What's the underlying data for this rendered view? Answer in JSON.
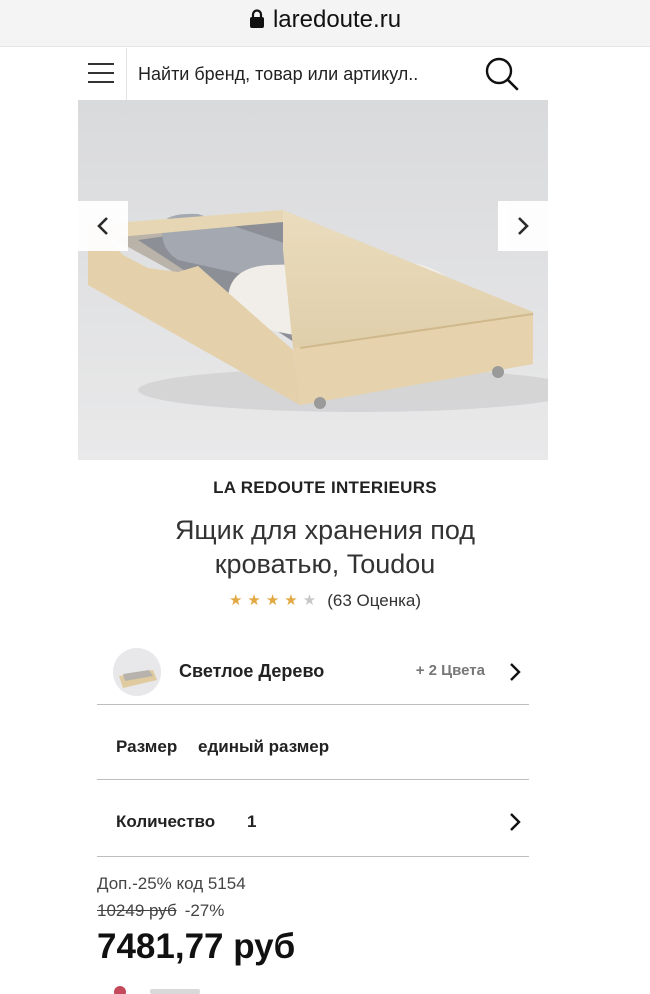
{
  "browser": {
    "domain": "laredoute.ru"
  },
  "header": {
    "search_placeholder": "Найти бренд, товар или артикул.."
  },
  "product": {
    "brand": "LA REDOUTE INTERIEURS",
    "title": "Ящик для хранения под кроватью, Toudou",
    "rating": {
      "stars": 4,
      "max": 5,
      "label": "(63 Оценка)"
    }
  },
  "options": {
    "color": {
      "name": "Светлое Дерево",
      "more": "+ 2 Цвета"
    },
    "size": {
      "label": "Размер",
      "value": "единый размер"
    },
    "quantity": {
      "label": "Количество",
      "value": "1"
    }
  },
  "pricing": {
    "promo": "Доп.-25% код 5154",
    "old_price": "10249 руб",
    "discount": "-27%",
    "price": "7481,77 руб"
  },
  "colors": {
    "star": "#e2a843",
    "star_empty": "#c8c8c8"
  },
  "icons": [
    "lock-icon",
    "menu-icon",
    "search-icon",
    "chevron-left-icon",
    "chevron-right-icon"
  ]
}
